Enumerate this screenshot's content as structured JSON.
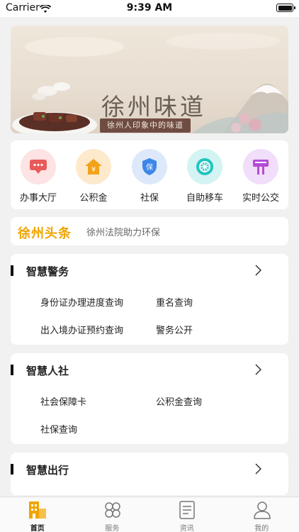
{
  "status_bar": {
    "carrier": "Carrier",
    "time": "9:39 AM"
  },
  "banner": {
    "title": "徐州味道",
    "subtitle": "徐州人印象中的味道"
  },
  "services": [
    {
      "label": "办事大厅",
      "icon": "hall-chat-icon",
      "color": "#e85a5a",
      "bg": "#fde3e3"
    },
    {
      "label": "公积金",
      "icon": "fund-house-icon",
      "color": "#f3a21b",
      "bg": "#fde9cc"
    },
    {
      "label": "社保",
      "icon": "social-security-shield-icon",
      "color": "#3d86e8",
      "bg": "#dde9fb"
    },
    {
      "label": "自助移车",
      "icon": "move-car-wheel-icon",
      "color": "#22c4c0",
      "bg": "#d3f4f2"
    },
    {
      "label": "实时公交",
      "icon": "bus-stop-sign-icon",
      "color": "#b44bd6",
      "bg": "#f1defa"
    }
  ],
  "headline": {
    "logo": "徐州头条",
    "news": "徐州法院助力环保"
  },
  "sections": [
    {
      "title": "智慧警务",
      "items": [
        "身份证办理进度查询",
        "重名查询",
        "出入境办证预约查询",
        "警务公开"
      ]
    },
    {
      "title": "智慧人社",
      "items": [
        "社会保障卡",
        "公积金查询",
        "社保查询"
      ]
    },
    {
      "title": "智慧出行",
      "items": []
    }
  ],
  "tabbar": [
    {
      "label": "首页",
      "icon": "home-building-icon",
      "active": true
    },
    {
      "label": "服务",
      "icon": "services-grid-icon",
      "active": false
    },
    {
      "label": "资讯",
      "icon": "news-document-icon",
      "active": false
    },
    {
      "label": "我的",
      "icon": "profile-person-icon",
      "active": false
    }
  ],
  "colors": {
    "accent": "#f0a400",
    "background": "#f1f1f1"
  }
}
